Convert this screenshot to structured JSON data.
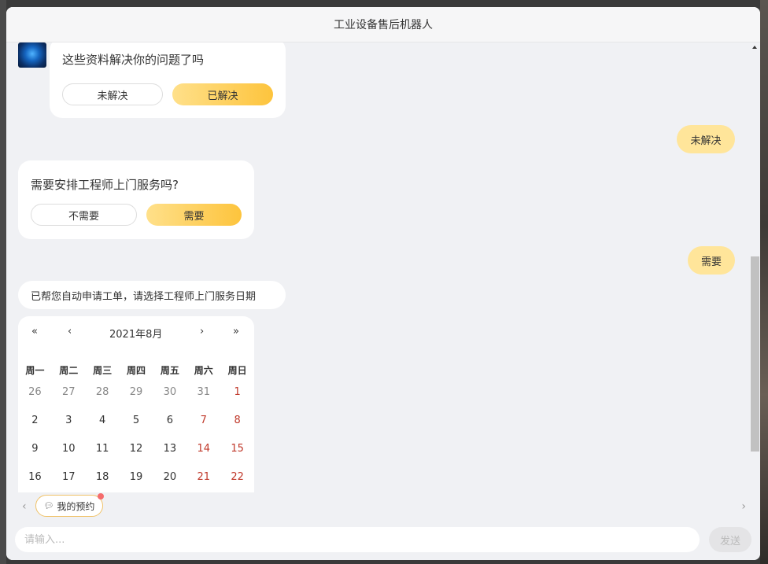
{
  "window": {
    "title": "工业设备售后机器人"
  },
  "messages": {
    "resolved_card": {
      "question": "这些资料解决你的问题了吗",
      "btn_no": "未解决",
      "btn_yes": "已解决"
    },
    "user_reply_1": "未解决",
    "engineer_card": {
      "question": "需要安排工程师上门服务吗?",
      "btn_no": "不需要",
      "btn_yes": "需要"
    },
    "user_reply_2": "需要",
    "bot_notice": "已帮您自动申请工单，请选择工程师上门服务日期"
  },
  "calendar": {
    "prev_year": "«",
    "prev_month": "‹",
    "month_label": "2021年8月",
    "next_month": "›",
    "next_year": "»",
    "weekdays": [
      "周一",
      "周二",
      "周三",
      "周四",
      "周五",
      "周六",
      "周日"
    ],
    "weeks": [
      [
        "26",
        "27",
        "28",
        "29",
        "30",
        "31",
        "1"
      ],
      [
        "2",
        "3",
        "4",
        "5",
        "6",
        "7",
        "8"
      ],
      [
        "9",
        "10",
        "11",
        "12",
        "13",
        "14",
        "15"
      ],
      [
        "16",
        "17",
        "18",
        "19",
        "20",
        "21",
        "22"
      ]
    ]
  },
  "quickbar": {
    "left_arrow": "‹",
    "right_arrow": "›",
    "chip_label": "我的预约",
    "chip_icon": "chat-bubble-icon"
  },
  "input": {
    "placeholder": "请输入...",
    "value": "",
    "send_label": "发送"
  },
  "colors": {
    "accent": "#fdc43d",
    "user_bubble": "#ffe59a",
    "weekend": "#c0392b",
    "badge": "#f56c6c"
  }
}
